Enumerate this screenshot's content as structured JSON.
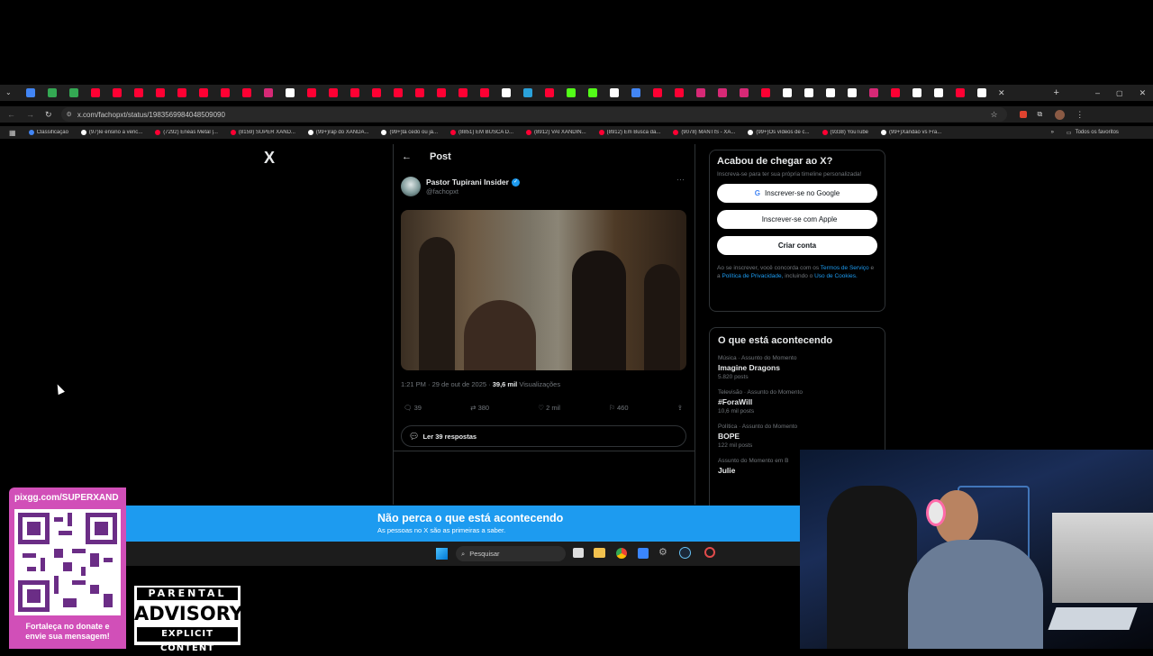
{
  "browser": {
    "url": "x.com/fachopxt/status/1983569984048509090",
    "bookmarks": [
      {
        "label": "Classificação",
        "color": "#4285f4"
      },
      {
        "label": "(97)Ie ensino a venc...",
        "color": "#ffffff"
      },
      {
        "label": "(7292) Enéas Metal |...",
        "color": "#ff0033"
      },
      {
        "label": "(8159) SUPER XAND...",
        "color": "#ff0033"
      },
      {
        "label": "(99+)rap do XANDÃ...",
        "color": "#ffffff"
      },
      {
        "label": "(99+)tá cedo ou já...",
        "color": "#ffffff"
      },
      {
        "label": "(8851) EM BUSCA D...",
        "color": "#ff0033"
      },
      {
        "label": "(8912) VAI XANDIN...",
        "color": "#ff0033"
      },
      {
        "label": "(8912) Em Busca da...",
        "color": "#ff0033"
      },
      {
        "label": "(9078) MANTIS - XA...",
        "color": "#ff0033"
      },
      {
        "label": "(99+)Os vídeos de c...",
        "color": "#ffffff"
      },
      {
        "label": "(9338) YouTube",
        "color": "#ff0033"
      },
      {
        "label": "(99+)Xandão vs Fra...",
        "color": "#ffffff"
      }
    ],
    "all_bookmarks_label": "Todos os favoritos"
  },
  "x_logo": "X",
  "post": {
    "header_title": "Post",
    "author_name": "Pastor Tupirani Insider",
    "author_handle": "@fachopxt",
    "time": "1:21 PM · 29 de out de 2025 ·",
    "views_count": "39,6 mil",
    "views_label": "Visualizações",
    "replies": "39",
    "reposts": "380",
    "likes": "2 mil",
    "bookmarks": "460",
    "read_replies": "Ler 39 respostas"
  },
  "signup": {
    "title": "Acabou de chegar ao X?",
    "subtitle": "Inscreva-se para ter sua própria timeline personalizada!",
    "google_button": "Inscrever-se no Google",
    "apple_button": "Inscrever-se com Apple",
    "create_button": "Criar conta",
    "legal_prefix": "Ao se inscrever, você concorda com os",
    "terms": "Termos de Serviço",
    "legal_and": "e a",
    "privacy": "Política de Privacidade,",
    "legal_incl": "incluindo o",
    "cookies": "Uso de Cookies."
  },
  "trends": {
    "title": "O que está acontecendo",
    "items": [
      {
        "category": "Música · Assunto do Momento",
        "name": "Imagine Dragons",
        "count": "5.820 posts"
      },
      {
        "category": "Televisão · Assunto do Momento",
        "name": "#ForaWill",
        "count": "10,6 mil posts"
      },
      {
        "category": "Política · Assunto do Momento",
        "name": "BOPE",
        "count": "122 mil posts"
      },
      {
        "category": "Assunto do Momento em B",
        "name": "Julie",
        "count": ""
      }
    ]
  },
  "banner": {
    "title": "Não perca o que está acontecendo",
    "subtitle": "As pessoas no X são as primeiras a saber."
  },
  "taskbar": {
    "search_placeholder": "Pesquisar"
  },
  "overlay": {
    "qr_url": "pixgg.com/SUPERXAND",
    "qr_caption": "Fortaleça no donate e envie sua mensagem!",
    "advisory_top": "PARENTAL",
    "advisory_mid": "ADVISORY",
    "advisory_bottom": "EXPLICIT CONTENT"
  },
  "colors": {
    "accent": "#1d9bf0",
    "verified": "#1d9bf0",
    "qr_frame": "#d14fb8"
  }
}
